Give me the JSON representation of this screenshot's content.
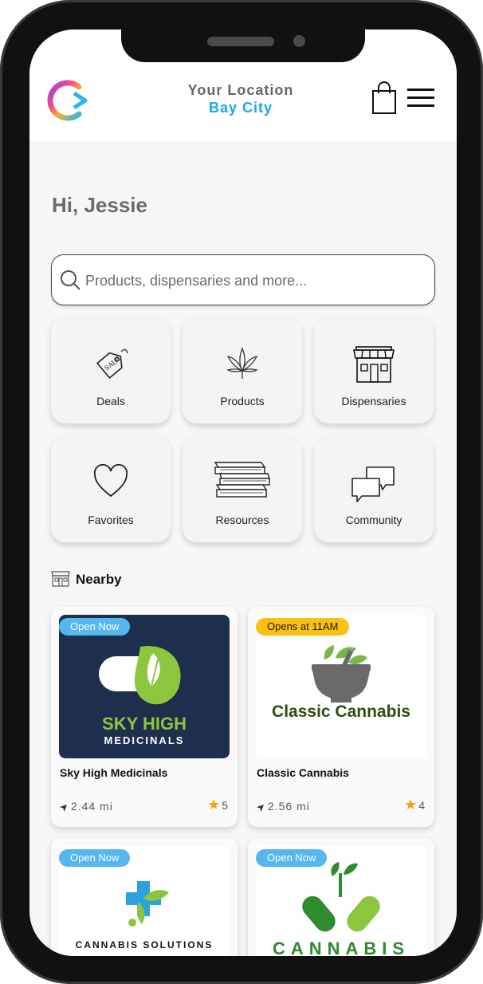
{
  "header": {
    "location_title": "Your Location",
    "location_city": "Bay City",
    "logo_icon": "app-logo",
    "bag_icon": "shopping-bag-icon",
    "menu_icon": "hamburger-menu-icon"
  },
  "greeting": "Hi, Jessie",
  "search": {
    "placeholder": "Products, dispensaries and more..."
  },
  "categories": [
    {
      "label": "Deals",
      "icon": "sale-tag-icon"
    },
    {
      "label": "Products",
      "icon": "cannabis-leaf-icon"
    },
    {
      "label": "Dispensaries",
      "icon": "storefront-icon"
    },
    {
      "label": "Favorites",
      "icon": "heart-icon"
    },
    {
      "label": "Resources",
      "icon": "books-icon"
    },
    {
      "label": "Community",
      "icon": "chat-bubbles-icon"
    }
  ],
  "nearby": {
    "title": "Nearby",
    "icon": "storefront-icon",
    "cards": [
      {
        "name": "Sky High Medicinals",
        "status": "Open Now",
        "distance": "2.44 mi",
        "rating": "5",
        "logo_line1": "SKY HIGH",
        "logo_line2": "MEDICINALS"
      },
      {
        "name": "Classic Cannabis",
        "status": "Opens at 11AM",
        "distance": "2.56 mi",
        "rating": "4",
        "logo_line1": "Classic Cannabis"
      },
      {
        "status": "Open Now",
        "logo_line1": "CANNABIS SOLUTIONS"
      },
      {
        "status": "Open Now",
        "logo_line1": "CANNABIS"
      }
    ]
  },
  "colors": {
    "accent_blue": "#1aa7ec",
    "badge_open": "#56b7f0",
    "badge_soon": "#fcbf14",
    "star": "#f5a20a",
    "sky_high_bg": "#1e2f4d",
    "green": "#8cc63f"
  }
}
